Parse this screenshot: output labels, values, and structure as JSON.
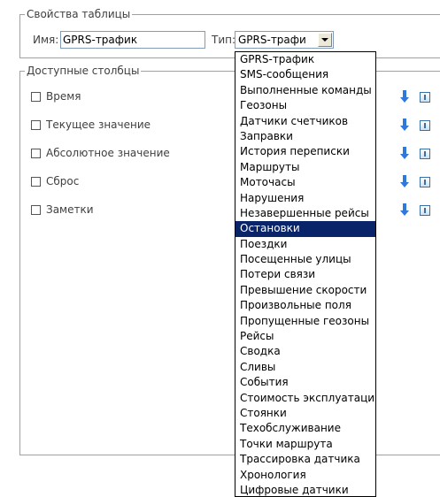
{
  "table_properties": {
    "legend": "Свойства таблицы",
    "name_label": "Имя:",
    "name_value": "GPRS-трафик",
    "type_label": "Тип:",
    "type_value": "GPRS-трафи"
  },
  "available_columns": {
    "legend": "Доступные столбцы",
    "items": [
      {
        "label": "Время",
        "checked": false
      },
      {
        "label": "Текущее значение",
        "checked": false
      },
      {
        "label": "Абсолютное значение",
        "checked": false
      },
      {
        "label": "Сброс",
        "checked": false
      },
      {
        "label": "Заметки",
        "checked": false
      }
    ]
  },
  "icons": {
    "move_down": "arrow-down-icon",
    "info": "info-icon",
    "accent": "#2f7ad8"
  },
  "type_dropdown": {
    "selected_index": 11,
    "selected_color": "#0a246a",
    "options": [
      "GPRS-трафик",
      "SMS-сообщения",
      "Выполненные команды",
      "Геозоны",
      "Датчики счетчиков",
      "Заправки",
      "История переписки",
      "Маршруты",
      "Моточасы",
      "Нарушения",
      "Незавершенные рейсы",
      "Остановки",
      "Поездки",
      "Посещенные улицы",
      "Потери связи",
      "Превышение скорости",
      "Произвольные поля",
      "Пропущенные геозоны",
      "Рейсы",
      "Сводка",
      "Сливы",
      "События",
      "Стоимость эксплуатации",
      "Стоянки",
      "Техобслуживание",
      "Точки маршрута",
      "Трассировка датчика",
      "Хронология",
      "Цифровые датчики"
    ]
  }
}
